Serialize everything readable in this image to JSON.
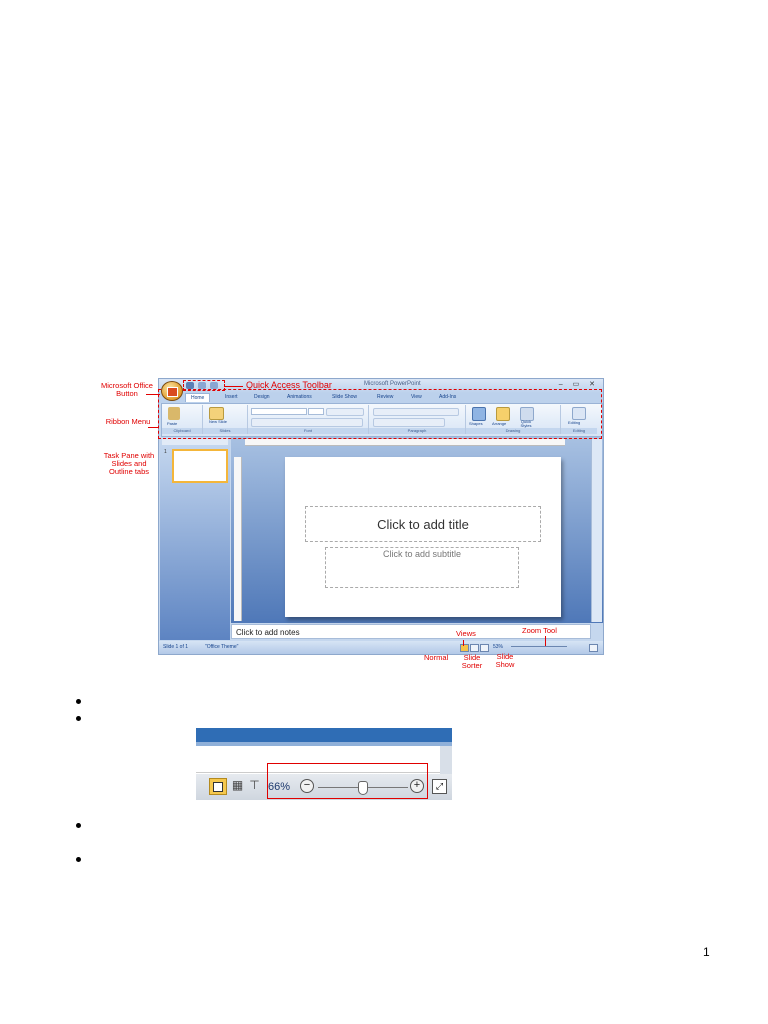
{
  "ppt": {
    "window_title": "Microsoft PowerPoint",
    "window_controls": "– ▭ ✕",
    "tabs": [
      "Home",
      "Insert",
      "Design",
      "Animations",
      "Slide Show",
      "Review",
      "View",
      "Add-Ins"
    ],
    "ribbon_groups": [
      "Clipboard",
      "Slides",
      "Font",
      "Paragraph",
      "Drawing",
      "Editing"
    ],
    "ribbon_buttons": {
      "paste": "Paste",
      "new_slide": "New Slide",
      "shapes": "Shapes",
      "arrange": "Arrange",
      "quick_styles": "Quick Styles",
      "editing": "Editing"
    },
    "thumb_number": "1",
    "slide_title_placeholder": "Click to add title",
    "slide_subtitle_placeholder": "Click to add subtitle",
    "notes_placeholder": "Click to add notes",
    "status_slide": "Slide 1 of 1",
    "status_theme": "\"Office Theme\"",
    "status_zoom": "53%"
  },
  "annotations": {
    "office_button": "Microsoft Office Button",
    "quick_access": "Quick Access Toolbar",
    "ribbon": "Ribbon Menu",
    "task_pane": "Task Pane with Slides and Outline tabs",
    "views": "Views",
    "zoom_tool": "Zoom Tool",
    "normal": "Normal",
    "slide_sorter": "Slide Sorter",
    "slide_show": "Slide Show"
  },
  "zoom_figure": {
    "zoom_percent": "66%",
    "minus": "−",
    "plus": "+",
    "slider_fraction": 0.5
  },
  "page_number": "1",
  "colors": {
    "annotation_red": "#e00000",
    "ribbon_blue": "#15428b",
    "slide_background": "#ffffff"
  },
  "icons": [
    "office-logo-icon",
    "save-icon",
    "undo-icon",
    "redo-icon",
    "normal-view-icon",
    "slide-sorter-icon",
    "slide-show-icon",
    "zoom-fit-icon"
  ]
}
